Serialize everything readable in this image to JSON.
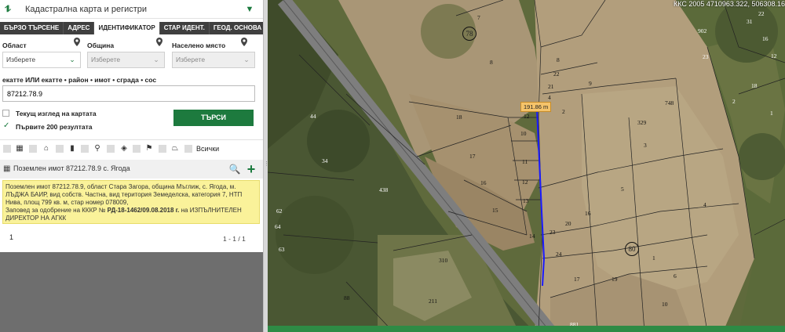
{
  "header": {
    "title": "Кадастрална карта и регистри"
  },
  "tabs": [
    {
      "label": "БЪРЗО ТЪРСЕНЕ"
    },
    {
      "label": "АДРЕС"
    },
    {
      "label": "ИДЕНТИФИКАТОР"
    },
    {
      "label": "СТАР ИДЕНТ."
    },
    {
      "label": "ГЕОД. ОСНОВА"
    }
  ],
  "filters": {
    "region_label": "Област",
    "region_value": "Изберете",
    "municipality_label": "Община",
    "municipality_value": "Изберете",
    "settlement_label": "Населено място",
    "settlement_value": "Изберете"
  },
  "query": {
    "label": "екатте ИЛИ екатте • район • имот • сграда • сос",
    "value": "87212.78.9"
  },
  "options": {
    "current_view": "Текущ изглед на картата",
    "first_200": "Първите 200 резултата"
  },
  "search_button": "ТЪРСИ",
  "filter_bar": {
    "all_label": "Всички"
  },
  "result": {
    "header": "Поземлен имот 87212.78.9 с. Ягода",
    "text_1": "Поземлен имот 87212.78.9, област Стара Загора, община Мъглиж, с. Ягода, м. ЛЪДЖА БАИР, вид собств. Частна, вид територия Земеделска, категория 7, НТП Нива, площ 799 кв. м, стар номер 078009,",
    "text_2a": "Заповед за одобрение на КККР №",
    "text_2b": "РД-18-1462/09.08.2018 г.",
    "text_2c": "на ИЗПЪЛНИТЕЛЕН ДИРЕКТОР НА АГКК"
  },
  "pager": {
    "page": "1",
    "count": "1 - 1 / 1"
  },
  "map": {
    "coords": "ККС 2005 4710963.322, 506308.16",
    "measure": "191.86 m",
    "parcels": [
      "7",
      "8",
      "78",
      "8",
      "22",
      "21",
      "4",
      "9",
      "748",
      "18",
      "12",
      "2",
      "329",
      "3",
      "10",
      "17",
      "11",
      "5",
      "12",
      "16",
      "13",
      "4",
      "15",
      "16",
      "14",
      "20",
      "23",
      "24",
      "80",
      "1",
      "17",
      "19",
      "6",
      "10",
      "44",
      "34",
      "438",
      "62",
      "64",
      "63",
      "88",
      "211",
      "310",
      "22",
      "31",
      "902",
      "16",
      "23",
      "12",
      "18",
      "2",
      "1",
      "881"
    ]
  },
  "colors": {
    "brand_green": "#1d7a3e",
    "tab_bar": "#3f3f3f",
    "result_bg": "#faf29a",
    "measure_line": "#1a1aff"
  }
}
